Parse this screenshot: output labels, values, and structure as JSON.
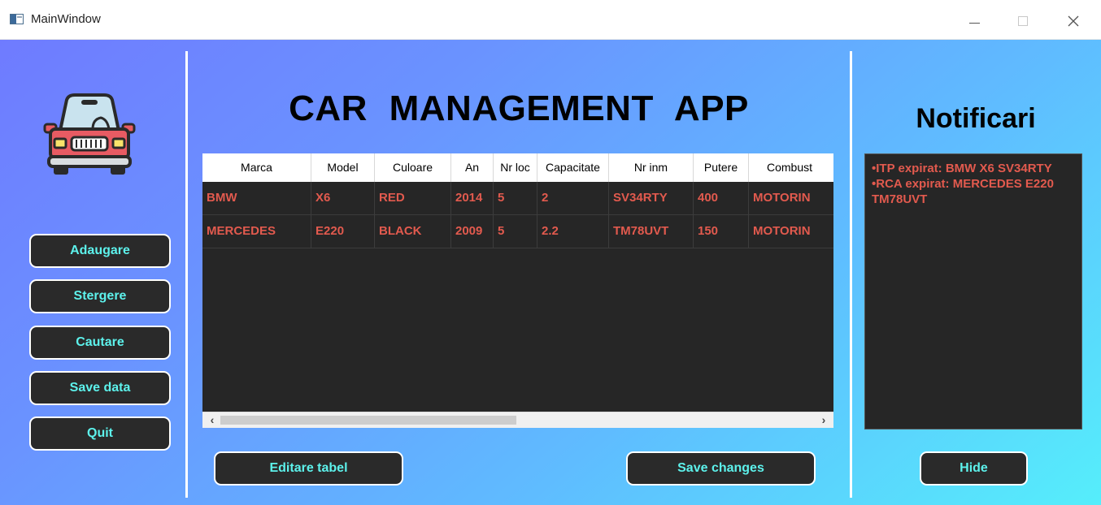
{
  "window": {
    "title": "MainWindow"
  },
  "header": {
    "app_title": "CAR  MANAGEMENT  APP"
  },
  "sidebar": {
    "buttons": [
      {
        "label": "Adaugare"
      },
      {
        "label": "Stergere"
      },
      {
        "label": "Cautare"
      },
      {
        "label": "Save data"
      },
      {
        "label": "Quit"
      }
    ]
  },
  "table": {
    "columns": [
      "Marca",
      "Model",
      "Culoare",
      "An",
      "Nr loc",
      "Capacitate",
      "Nr inm",
      "Putere",
      "Combust"
    ],
    "rows": [
      [
        "BMW",
        "X6",
        "RED",
        "2014",
        "5",
        "2",
        "SV34RTY",
        "400",
        "MOTORIN"
      ],
      [
        "MERCEDES",
        "E220",
        "BLACK",
        "2009",
        "5",
        "2.2",
        "TM78UVT",
        "150",
        "MOTORIN"
      ]
    ]
  },
  "actions": {
    "edit_label": "Editare tabel",
    "save_label": "Save changes"
  },
  "notifications": {
    "title": "Notificari",
    "items": [
      "•ITP expirat: BMW X6 SV34RTY",
      "•RCA expirat: MERCEDES E220 TM78UVT"
    ],
    "hide_label": "Hide"
  },
  "colors": {
    "button_text": "#5df2ec",
    "button_bg": "#2a2a2a",
    "row_text": "#e25a4e",
    "panel_bg": "#262626"
  }
}
